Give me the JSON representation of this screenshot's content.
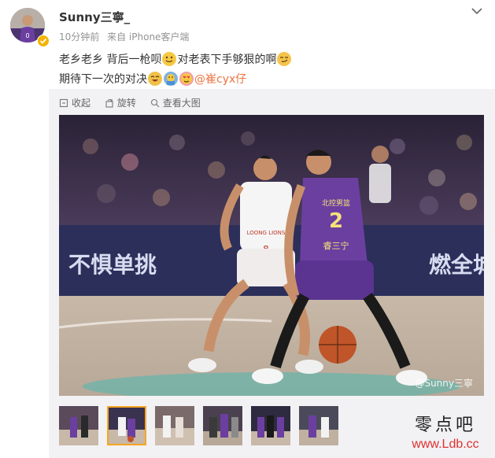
{
  "post": {
    "username": "Sunny三寧_",
    "time": "10分钟前",
    "source": "来自 iPhone客户端",
    "line1": "老乡老乡 背后一枪呗",
    "line1b": "对老表下手够狠的啊",
    "line2": "期待下一次的对决",
    "mention": "@崔cyx仔"
  },
  "toolbar": {
    "collapse": "收起",
    "rotate": "旋转",
    "view_large": "查看大图"
  },
  "photo": {
    "watermark": "@Sunny三寧",
    "banner_left": "不惧单挑",
    "banner_right": "燃全城",
    "jersey_number": "2",
    "jersey_name": "睿三宁",
    "jersey_team": "北控男篮",
    "opponent_number": "8",
    "opponent_team": "LOONG LIONS"
  },
  "thumbnails": [
    {
      "label": "photo-1"
    },
    {
      "label": "photo-2"
    },
    {
      "label": "photo-3"
    },
    {
      "label": "photo-4"
    },
    {
      "label": "photo-5"
    },
    {
      "label": "photo-6"
    }
  ],
  "site_badge": {
    "name": "零点吧",
    "url": "www.Ldb.cc"
  },
  "icons": {
    "collapse": "collapse-icon",
    "rotate": "rotate-icon",
    "view_large": "zoom-icon",
    "more": "chevron-down-icon",
    "verified": "verified-badge-icon"
  },
  "colors": {
    "mention": "#eb7340",
    "meta_gray": "#939393",
    "panel_bg": "#f2f2f5",
    "active_thumb": "#f5a623",
    "verified": "#f5b400"
  }
}
